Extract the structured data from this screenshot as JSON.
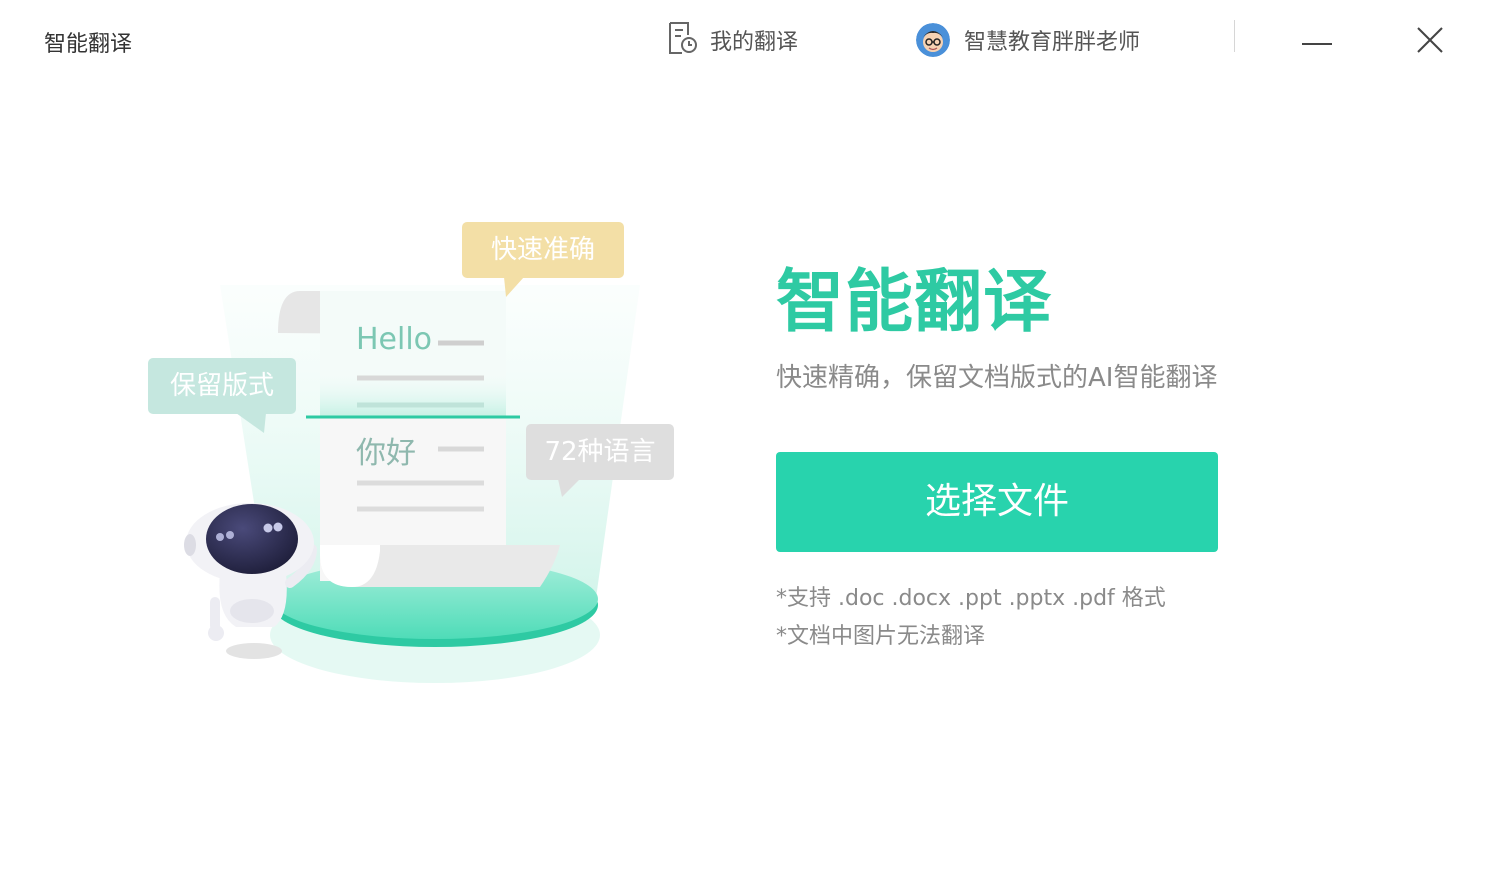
{
  "titlebar": {
    "app_title": "智能翻译",
    "history_label": "我的翻译",
    "user_name": "智慧教育胖胖老师"
  },
  "illustration": {
    "bubble_fast": "快速准确",
    "bubble_format": "保留版式",
    "bubble_languages": "72种语言",
    "doc_source": "Hello",
    "doc_target": "你好"
  },
  "main": {
    "title": "智能翻译",
    "subtitle": "快速精确，保留文档版式的AI智能翻译",
    "select_button": "选择文件",
    "note_formats": "*支持 .doc .docx .ppt .pptx .pdf 格式",
    "note_images": "*文档中图片无法翻译"
  },
  "icons": {
    "history": "document-history-icon",
    "avatar": "user-avatar",
    "minimize": "minimize-icon",
    "close": "close-icon"
  },
  "colors": {
    "accent": "#28d3ad",
    "title": "#2ecaa3",
    "bubble_fast": "#f3dfa6",
    "bubble_format": "#c5e7df",
    "bubble_languages": "#dedede"
  }
}
